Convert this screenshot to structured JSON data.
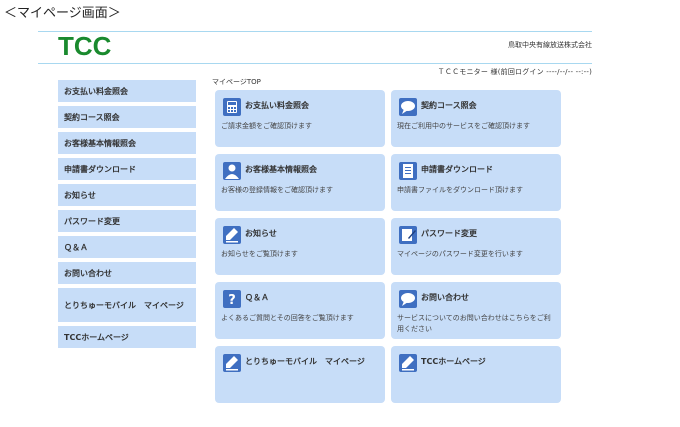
{
  "caption": "＜マイページ画面＞",
  "header": {
    "logo_text": "TCC",
    "company": "鳥取中央有線放送株式会社",
    "user_line": "ＴＣＣモニター 様(前回ログイン ----/--/-- --:--)"
  },
  "breadcrumb": "マイページTOP",
  "sidebar": {
    "items": [
      {
        "label": "お支払い料金照会"
      },
      {
        "label": "契約コース照会"
      },
      {
        "label": "お客様基本情報照会"
      },
      {
        "label": "申請書ダウンロード"
      },
      {
        "label": "お知らせ"
      },
      {
        "label": "パスワード変更"
      },
      {
        "label": "Ｑ＆Ａ"
      },
      {
        "label": "お問い合わせ"
      },
      {
        "label": "とりちゅーモバイル　マイページ"
      },
      {
        "label": "TCCホームページ"
      }
    ]
  },
  "cards": [
    {
      "title": "お支払い料金照会",
      "desc": "ご請求金額をご確認頂けます",
      "icon": "calculator-icon"
    },
    {
      "title": "契約コース照会",
      "desc": "現在ご利用中のサービスをご確認頂けます",
      "icon": "chat-icon"
    },
    {
      "title": "お客様基本情報照会",
      "desc": "お客様の登録情報をご確認頂けます",
      "icon": "user-icon"
    },
    {
      "title": "申請書ダウンロード",
      "desc": "申請書ファイルをダウンロード頂けます",
      "icon": "document-icon"
    },
    {
      "title": "お知らせ",
      "desc": "お知らせをご覧頂けます",
      "icon": "pencil-icon"
    },
    {
      "title": "パスワード変更",
      "desc": "マイページのパスワード変更を行います",
      "icon": "edit-icon"
    },
    {
      "title": "Ｑ＆Ａ",
      "desc": "よくあるご質問とその回答をご覧頂けます",
      "icon": "question-icon"
    },
    {
      "title": "お問い合わせ",
      "desc": "サービスについてのお問い合わせはこちらをご利用ください",
      "icon": "chat-icon"
    },
    {
      "title": "とりちゅーモバイル　マイページ",
      "desc": "",
      "icon": "pencil-icon"
    },
    {
      "title": "TCCホームページ",
      "desc": "",
      "icon": "pencil-icon"
    }
  ],
  "colors": {
    "card_bg": "#c7ddf8",
    "icon_blue": "#3f6fc1",
    "logo_green": "#1a8a2e",
    "rule_blue": "#a8d8f0"
  }
}
